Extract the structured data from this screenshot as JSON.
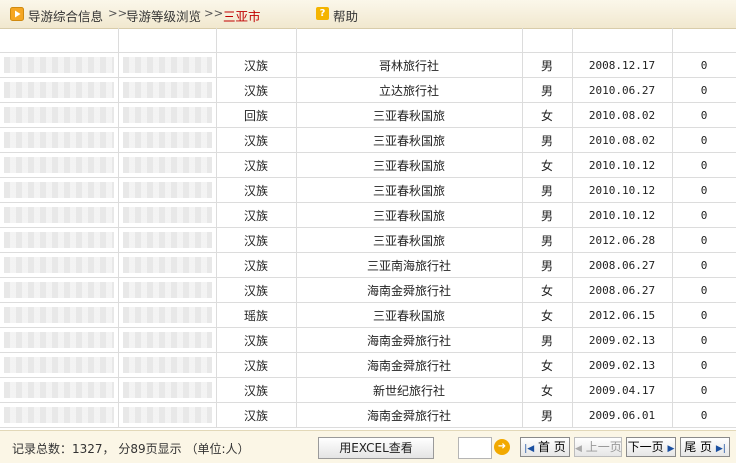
{
  "breadcrumb": {
    "item1": "导游综合信息",
    "sep1": ">>",
    "item2": "导游等级浏览",
    "sep2": ">>",
    "item3": "三亚市",
    "help": "帮助"
  },
  "table": {
    "rows": [
      {
        "ethnicity": "汉族",
        "agency": "哥林旅行社",
        "gender": "男",
        "date": "2008.12.17",
        "count": "0"
      },
      {
        "ethnicity": "汉族",
        "agency": "立达旅行社",
        "gender": "男",
        "date": "2010.06.27",
        "count": "0"
      },
      {
        "ethnicity": "回族",
        "agency": "三亚春秋国旅",
        "gender": "女",
        "date": "2010.08.02",
        "count": "0"
      },
      {
        "ethnicity": "汉族",
        "agency": "三亚春秋国旅",
        "gender": "男",
        "date": "2010.08.02",
        "count": "0"
      },
      {
        "ethnicity": "汉族",
        "agency": "三亚春秋国旅",
        "gender": "女",
        "date": "2010.10.12",
        "count": "0"
      },
      {
        "ethnicity": "汉族",
        "agency": "三亚春秋国旅",
        "gender": "男",
        "date": "2010.10.12",
        "count": "0"
      },
      {
        "ethnicity": "汉族",
        "agency": "三亚春秋国旅",
        "gender": "男",
        "date": "2010.10.12",
        "count": "0"
      },
      {
        "ethnicity": "汉族",
        "agency": "三亚春秋国旅",
        "gender": "男",
        "date": "2012.06.28",
        "count": "0"
      },
      {
        "ethnicity": "汉族",
        "agency": "三亚南海旅行社",
        "gender": "男",
        "date": "2008.06.27",
        "count": "0"
      },
      {
        "ethnicity": "汉族",
        "agency": "海南金舜旅行社",
        "gender": "女",
        "date": "2008.06.27",
        "count": "0"
      },
      {
        "ethnicity": "瑶族",
        "agency": "三亚春秋国旅",
        "gender": "女",
        "date": "2012.06.15",
        "count": "0"
      },
      {
        "ethnicity": "汉族",
        "agency": "海南金舜旅行社",
        "gender": "男",
        "date": "2009.02.13",
        "count": "0"
      },
      {
        "ethnicity": "汉族",
        "agency": "海南金舜旅行社",
        "gender": "女",
        "date": "2009.02.13",
        "count": "0"
      },
      {
        "ethnicity": "汉族",
        "agency": "新世纪旅行社",
        "gender": "女",
        "date": "2009.04.17",
        "count": "0"
      },
      {
        "ethnicity": "汉族",
        "agency": "海南金舜旅行社",
        "gender": "男",
        "date": "2009.06.01",
        "count": "0"
      }
    ]
  },
  "footer": {
    "summary": "记录总数：1327， 分89页显示  （单位:人）",
    "excel_button": "用EXCEL查看",
    "page_input_value": "",
    "first": "首 页",
    "prev": "上一页",
    "next": "下一页",
    "last": "尾 页"
  }
}
